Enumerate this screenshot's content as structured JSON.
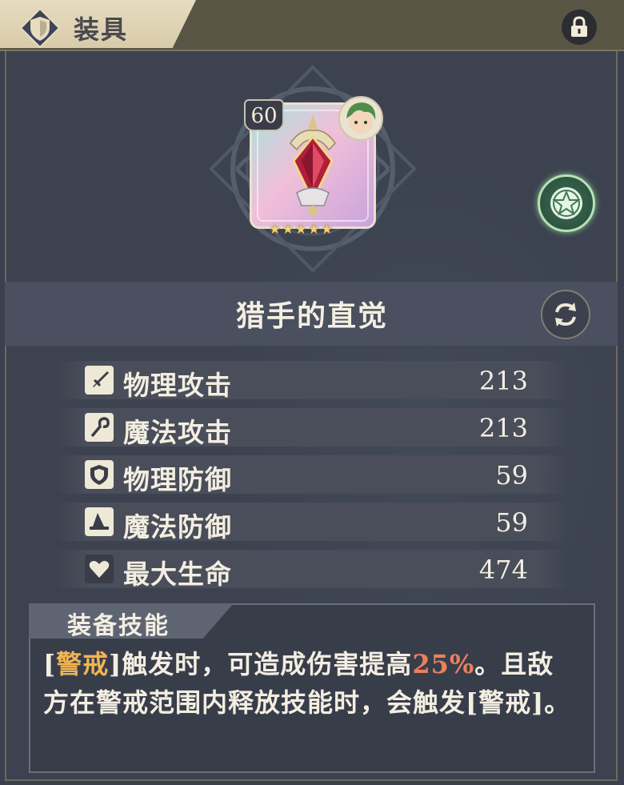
{
  "header": {
    "title": "装具",
    "shield_icon": "shield-icon",
    "lock_icon": "lock-icon"
  },
  "equipment": {
    "level": "60",
    "stars": "★★★★★",
    "star_count": 5,
    "name": "猎手的直觉"
  },
  "stats": [
    {
      "icon": "sword-icon",
      "label": "物理攻击",
      "value": "213"
    },
    {
      "icon": "staff-icon",
      "label": "魔法攻击",
      "value": "213"
    },
    {
      "icon": "shield-icon",
      "label": "物理防御",
      "value": "59"
    },
    {
      "icon": "wizard-hat-icon",
      "label": "魔法防御",
      "value": "59"
    },
    {
      "icon": "heart-icon",
      "label": "最大生命",
      "value": "474"
    }
  ],
  "skill": {
    "title": "装备技能",
    "desc_open_bracket": "[",
    "desc_keyword_1": "警戒",
    "desc_part_1": "]触发时，可造成伤害提高",
    "desc_percent": "25%",
    "desc_part_2": "。且敌方在警戒范围内释放技能时，会触发[警戒]。"
  },
  "colors": {
    "highlight_keyword": "#f1b552",
    "highlight_percent": "#e9815d",
    "text": "#f3eee1"
  }
}
